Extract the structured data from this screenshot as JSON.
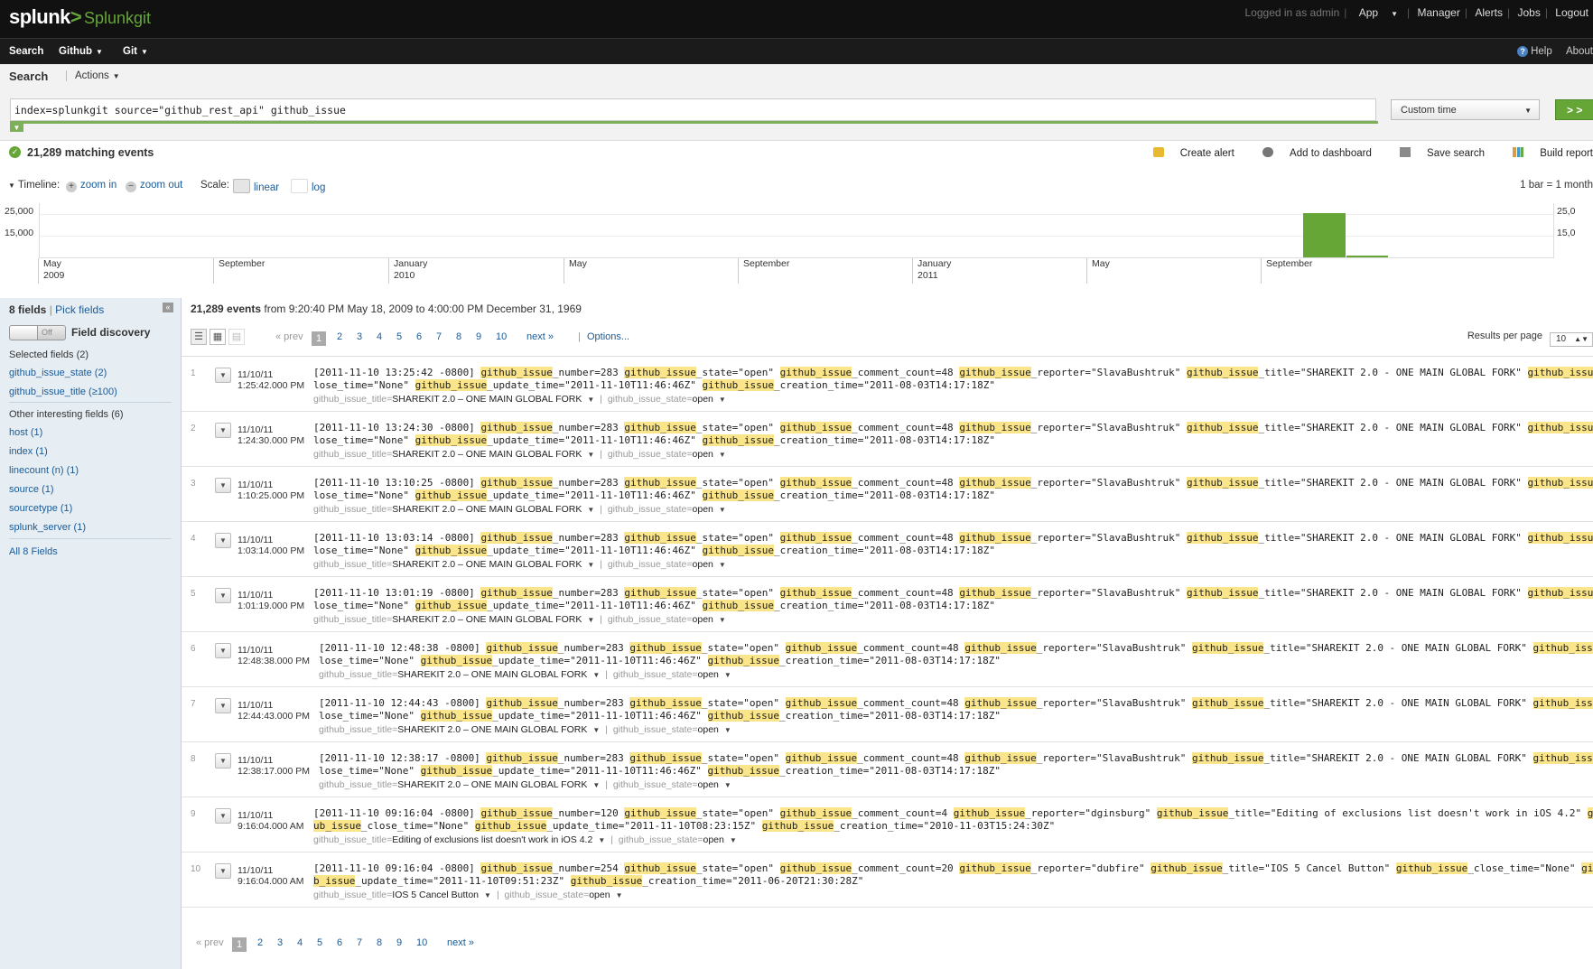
{
  "header": {
    "logo_text": "splunk",
    "logo_mark": ">",
    "app_name": "Splunkgit",
    "logged_in": "Logged in as admin",
    "app_menu": "App",
    "manager": "Manager",
    "alerts": "Alerts",
    "jobs": "Jobs",
    "logout": "Logout"
  },
  "nav": {
    "search": "Search",
    "github": "Github",
    "git": "Git",
    "help": "Help",
    "about": "About"
  },
  "search_header": {
    "title": "Search",
    "actions": "Actions"
  },
  "search": {
    "query": "index=splunkgit source=\"github_rest_api\"  github_issue",
    "time_range": "Custom time",
    "go_label": "> >"
  },
  "status": {
    "matching": "21,289 matching events",
    "create_alert": "Create alert",
    "add_dashboard": "Add to dashboard",
    "save_search": "Save search",
    "build_report": "Build report"
  },
  "timeline_controls": {
    "label": "Timeline:",
    "zoom_in": "zoom in",
    "zoom_out": "zoom out",
    "scale_label": "Scale:",
    "linear": "linear",
    "log": "log",
    "bar_info": "1 bar = 1 month"
  },
  "chart_data": {
    "type": "bar",
    "y_ticks": [
      "25,000",
      "15,000"
    ],
    "y_right_ticks": [
      "25,0",
      "15,0"
    ],
    "x_ticks": [
      {
        "label": "May",
        "year": "2009"
      },
      {
        "label": "September",
        "year": ""
      },
      {
        "label": "January",
        "year": "2010"
      },
      {
        "label": "May",
        "year": ""
      },
      {
        "label": "September",
        "year": ""
      },
      {
        "label": "January",
        "year": "2011"
      },
      {
        "label": "May",
        "year": ""
      },
      {
        "label": "September",
        "year": ""
      }
    ],
    "bars": [
      {
        "month": "2011-10",
        "value": 20500
      },
      {
        "month": "2011-11",
        "value": 800
      }
    ],
    "ylim": [
      0,
      25000
    ],
    "color": "#65a637"
  },
  "fields": {
    "header": "8 fields",
    "pick": "Pick fields",
    "toggle": "Off",
    "discovery": "Field discovery",
    "selected_title": "Selected fields (2)",
    "selected": [
      "github_issue_state (2)",
      "github_issue_title (≥100)"
    ],
    "other_title": "Other interesting fields (6)",
    "other": [
      "host (1)",
      "index (1)",
      "linecount (n) (1)",
      "source (1)",
      "sourcetype (1)",
      "splunk_server (1)"
    ],
    "all": "All 8 Fields"
  },
  "results": {
    "count": "21,289 events",
    "range": "from 9:20:40 PM May 18, 2009 to 4:00:00 PM December 31, 1969",
    "prev": "« prev",
    "next": "next »",
    "pages": [
      "1",
      "2",
      "3",
      "4",
      "5",
      "6",
      "7",
      "8",
      "9",
      "10"
    ],
    "options": "Options...",
    "rpp_label": "Results per page",
    "rpp_value": "10"
  },
  "events": [
    {
      "num": "1",
      "date": "11/10/11",
      "time": "1:25:42.000 PM",
      "stamp": "[2011-11-10 13:25:42 -0800]",
      "number": "283",
      "comments": "48",
      "reporter": "SlavaBushtruk",
      "title": "SHAREKIT 2.0 - ONE MAIN GLOBAL FORK",
      "update": "2011-11-10T11:46:46Z",
      "created": "2011-08-03T14:17:18Z",
      "f_title": "SHAREKIT 2.0 – ONE MAIN GLOBAL FORK",
      "f_state": "open"
    },
    {
      "num": "2",
      "date": "11/10/11",
      "time": "1:24:30.000 PM",
      "stamp": "[2011-11-10 13:24:30 -0800]",
      "number": "283",
      "comments": "48",
      "reporter": "SlavaBushtruk",
      "title": "SHAREKIT 2.0 - ONE MAIN GLOBAL FORK",
      "update": "2011-11-10T11:46:46Z",
      "created": "2011-08-03T14:17:18Z",
      "f_title": "SHAREKIT 2.0 – ONE MAIN GLOBAL FORK",
      "f_state": "open"
    },
    {
      "num": "3",
      "date": "11/10/11",
      "time": "1:10:25.000 PM",
      "stamp": "[2011-11-10 13:10:25 -0800]",
      "number": "283",
      "comments": "48",
      "reporter": "SlavaBushtruk",
      "title": "SHAREKIT 2.0 - ONE MAIN GLOBAL FORK",
      "update": "2011-11-10T11:46:46Z",
      "created": "2011-08-03T14:17:18Z",
      "f_title": "SHAREKIT 2.0 – ONE MAIN GLOBAL FORK",
      "f_state": "open"
    },
    {
      "num": "4",
      "date": "11/10/11",
      "time": "1:03:14.000 PM",
      "stamp": "[2011-11-10 13:03:14 -0800]",
      "number": "283",
      "comments": "48",
      "reporter": "SlavaBushtruk",
      "title": "SHAREKIT 2.0 - ONE MAIN GLOBAL FORK",
      "update": "2011-11-10T11:46:46Z",
      "created": "2011-08-03T14:17:18Z",
      "f_title": "SHAREKIT 2.0 – ONE MAIN GLOBAL FORK",
      "f_state": "open"
    },
    {
      "num": "5",
      "date": "11/10/11",
      "time": "1:01:19.000 PM",
      "stamp": "[2011-11-10 13:01:19 -0800]",
      "number": "283",
      "comments": "48",
      "reporter": "SlavaBushtruk",
      "title": "SHAREKIT 2.0 - ONE MAIN GLOBAL FORK",
      "update": "2011-11-10T11:46:46Z",
      "created": "2011-08-03T14:17:18Z",
      "f_title": "SHAREKIT 2.0 – ONE MAIN GLOBAL FORK",
      "f_state": "open"
    },
    {
      "num": "6",
      "date": "11/10/11",
      "time": "12:48:38.000 PM",
      "stamp": "[2011-11-10 12:48:38 -0800]",
      "number": "283",
      "comments": "48",
      "reporter": "SlavaBushtruk",
      "title": "SHAREKIT 2.0 - ONE MAIN GLOBAL FORK",
      "update": "2011-11-10T11:46:46Z",
      "created": "2011-08-03T14:17:18Z",
      "f_title": "SHAREKIT 2.0 – ONE MAIN GLOBAL FORK",
      "f_state": "open"
    },
    {
      "num": "7",
      "date": "11/10/11",
      "time": "12:44:43.000 PM",
      "stamp": "[2011-11-10 12:44:43 -0800]",
      "number": "283",
      "comments": "48",
      "reporter": "SlavaBushtruk",
      "title": "SHAREKIT 2.0 - ONE MAIN GLOBAL FORK",
      "update": "2011-11-10T11:46:46Z",
      "created": "2011-08-03T14:17:18Z",
      "f_title": "SHAREKIT 2.0 – ONE MAIN GLOBAL FORK",
      "f_state": "open"
    },
    {
      "num": "8",
      "date": "11/10/11",
      "time": "12:38:17.000 PM",
      "stamp": "[2011-11-10 12:38:17 -0800]",
      "number": "283",
      "comments": "48",
      "reporter": "SlavaBushtruk",
      "title": "SHAREKIT 2.0 - ONE MAIN GLOBAL FORK",
      "update": "2011-11-10T11:46:46Z",
      "created": "2011-08-03T14:17:18Z",
      "f_title": "SHAREKIT 2.0 – ONE MAIN GLOBAL FORK",
      "f_state": "open"
    },
    {
      "num": "9",
      "date": "11/10/11",
      "time": "9:16:04.000 AM",
      "stamp": "[2011-11-10 09:16:04 -0800]",
      "number": "120",
      "comments": "4",
      "reporter": "dginsburg",
      "title": "Editing of exclusions list doesn't work in iOS 4.2",
      "update": "2011-11-10T08:23:15Z",
      "created": "2010-11-03T15:24:30Z",
      "f_title": "Editing of exclusions list doesn't work in iOS 4.2",
      "f_state": "open"
    },
    {
      "num": "10",
      "date": "11/10/11",
      "time": "9:16:04.000 AM",
      "stamp": "[2011-11-10 09:16:04 -0800]",
      "number": "254",
      "comments": "20",
      "reporter": "dubfire",
      "title": "IOS 5 Cancel Button",
      "update": "2011-11-10T09:51:23Z",
      "created": "2011-06-20T21:30:28Z",
      "f_title": "IOS 5 Cancel Button",
      "f_state": "open"
    }
  ]
}
